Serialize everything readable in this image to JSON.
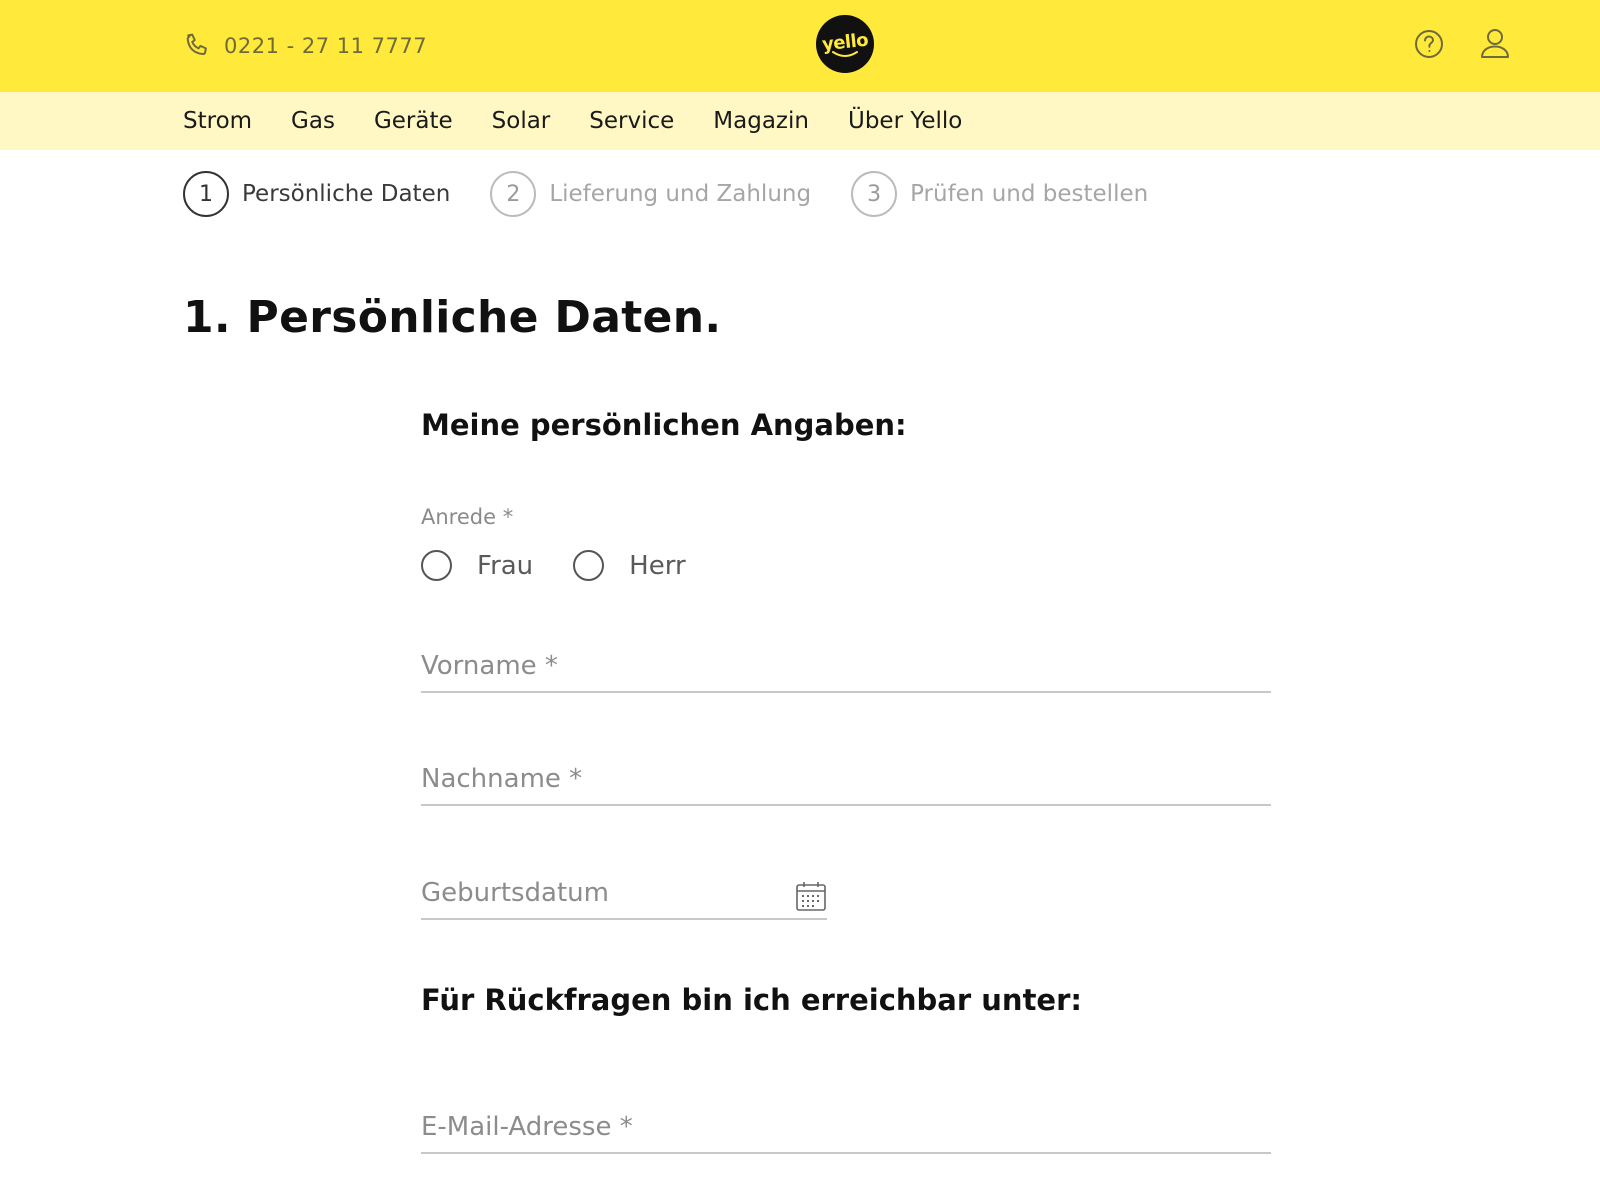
{
  "header": {
    "phone": "0221 - 27 11 7777",
    "logo_text": "yello"
  },
  "nav": {
    "items": [
      {
        "label": "Strom"
      },
      {
        "label": "Gas"
      },
      {
        "label": "Geräte"
      },
      {
        "label": "Solar"
      },
      {
        "label": "Service"
      },
      {
        "label": "Magazin"
      },
      {
        "label": "Über Yello"
      }
    ]
  },
  "steps": [
    {
      "number": "1",
      "label": "Persönliche Daten",
      "active": true
    },
    {
      "number": "2",
      "label": "Lieferung und Zahlung",
      "active": false
    },
    {
      "number": "3",
      "label": "Prüfen und bestellen",
      "active": false
    }
  ],
  "main": {
    "page_title": "1. Persönliche Daten.",
    "section_personal": "Meine persönlichen Angaben:",
    "anrede_label": "Anrede *",
    "anrede_options": [
      "Frau",
      "Herr"
    ],
    "vorname_placeholder": "Vorname *",
    "nachname_placeholder": "Nachname *",
    "geburtsdatum_placeholder": "Geburtsdatum",
    "section_contact": "Für Rückfragen bin ich erreichbar unter:",
    "email_placeholder": "E-Mail-Adresse *"
  },
  "colors": {
    "brand_yellow": "#ffe93a",
    "nav_yellow": "#fff8c4"
  }
}
